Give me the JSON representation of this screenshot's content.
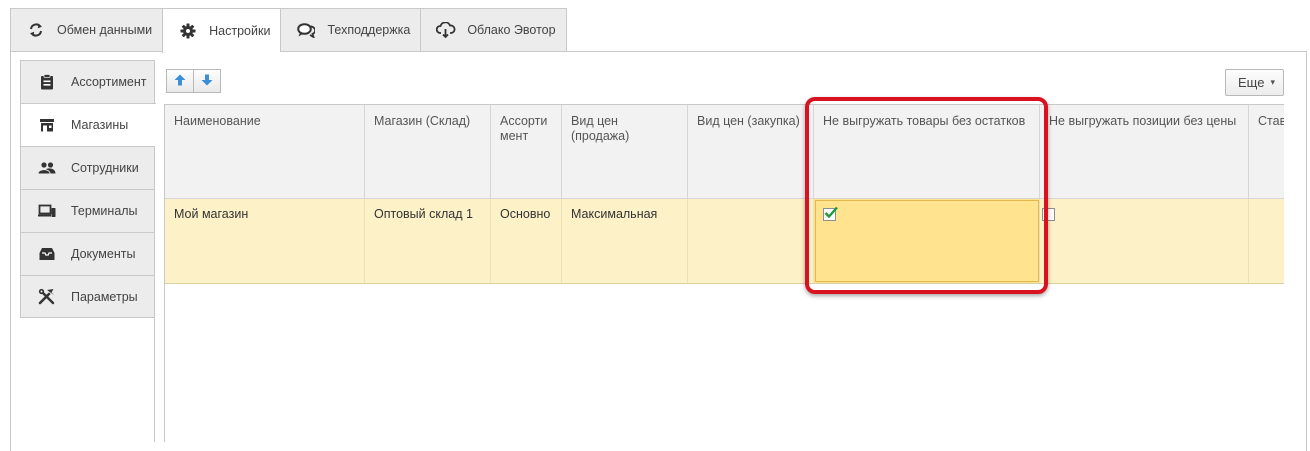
{
  "top_tabs": [
    {
      "label": "Обмен данными",
      "icon": "refresh-icon",
      "active": false
    },
    {
      "label": "Настройки",
      "icon": "gear-icon",
      "active": true
    },
    {
      "label": "Техподдержка",
      "icon": "chat-icon",
      "active": false
    },
    {
      "label": "Облако Эвотор",
      "icon": "cloud-icon",
      "active": false
    }
  ],
  "sidebar": {
    "items": [
      {
        "label": "Ассортимент",
        "icon": "clipboard-icon",
        "active": false
      },
      {
        "label": "Магазины",
        "icon": "store-icon",
        "active": true
      },
      {
        "label": "Сотрудники",
        "icon": "people-icon",
        "active": false
      },
      {
        "label": "Терминалы",
        "icon": "devices-icon",
        "active": false
      },
      {
        "label": "Документы",
        "icon": "inbox-icon",
        "active": false
      },
      {
        "label": "Параметры",
        "icon": "tools-icon",
        "active": false
      }
    ]
  },
  "toolbar": {
    "move_up_icon": "arrow-up-icon",
    "move_down_icon": "arrow-down-icon",
    "more_label": "Еще",
    "more_caret": "▾"
  },
  "table": {
    "columns": [
      "Наименование",
      "Магазин (Склад)",
      "Ассортимент",
      "Вид цен (продажа)",
      "Вид цен (закупка)",
      "Не выгружать товары без остатков",
      "Не выгружать позиции без цены",
      "Став"
    ],
    "header_display": [
      "Наименование",
      "Магазин (Склад)",
      "Ассорти\nмент",
      "Вид цен\n(продажа)",
      "Вид цен (закупка)",
      "Не выгружать товары без остатков",
      "Не выгружать позиции без цены",
      "Став"
    ],
    "rows": [
      {
        "name": "Мой магазин",
        "store": "Оптовый склад 1",
        "assortment": "Основно",
        "price_sale": "Максимальная",
        "price_purchase": "",
        "skip_no_stock": true,
        "skip_no_price": false,
        "rate": ""
      }
    ]
  },
  "colors": {
    "accent_blue": "#3b8fd9",
    "checkbox_green": "#1f9a3a",
    "selected_row": "#fdf1c8",
    "selected_cell": "#ffe38e",
    "callout_red": "#d8121e"
  }
}
